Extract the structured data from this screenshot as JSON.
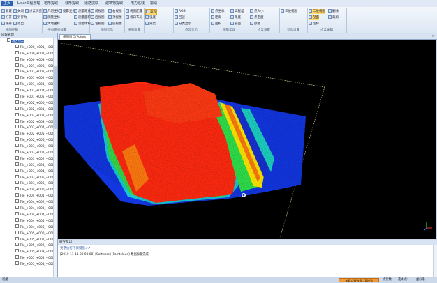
{
  "menu": {
    "tabs": [
      "主页",
      "Lidar工程管理",
      "地形提取",
      "线形提取",
      "道路提取",
      "建筑物提取",
      "电力巡线",
      "帮助"
    ],
    "active": 0
  },
  "ribbon": {
    "groups": [
      {
        "caption": "视图控制",
        "buttons": [
          "新建",
          "打开",
          "保存",
          "关闭",
          "另存为",
          "退出"
        ]
      },
      {
        "caption": "",
        "buttons": [
          "点云浏览"
        ]
      },
      {
        "caption": "坐标系统设置",
        "buttons": [
          "几何坐标",
          "测量坐标",
          "大地坐标",
          "投影变换"
        ]
      },
      {
        "caption": "",
        "buttons": [
          "测量距离",
          "测量面积",
          "测量体积"
        ]
      },
      {
        "caption": "视图显示",
        "buttons": [
          "前视图",
          "后视图",
          "左视图",
          "右视图",
          "顶视图",
          "底视图"
        ]
      },
      {
        "caption": "视图设置",
        "buttons": [
          "视图配置",
          "视口布局"
        ]
      },
      {
        "caption": "",
        "buttons": [
          "高程",
          "强度",
          "分类"
        ]
      },
      {
        "caption": "点云显示",
        "buttons": [
          "RGB",
          "回波",
          "分类显示"
        ]
      },
      {
        "caption": "测量工具",
        "buttons": [
          "点坐标",
          "距离",
          "面积",
          "高程差",
          "角度",
          "剖面"
        ]
      },
      {
        "caption": "点云设置",
        "buttons": [
          "点大小",
          "点密度",
          "颜色"
        ]
      },
      {
        "caption": "显示设置",
        "buttons": [
          "三维视图"
        ]
      },
      {
        "caption": "点云编辑",
        "buttons": [
          "二维视图",
          "剖面",
          "选择",
          "删除",
          "裁剪"
        ]
      }
    ]
  },
  "left_panel": {
    "title": "内容管理",
    "root": "测区点云",
    "nodes": [
      "Tile_+000_+001_+000",
      "Tile_+000_+002_+000",
      "Tile_+000_+003_+000",
      "Tile_+001_+000_+000",
      "Tile_+001_+001_+000",
      "Tile_+001_+002_+000",
      "Tile_+001_+003_+000",
      "Tile_+001_+004_+000",
      "Tile_+001_+005_+000",
      "Tile_+002_+000_+000",
      "Tile_+002_+001_+000",
      "Tile_+002_+002_+000",
      "Tile_+002_+003_+000",
      "Tile_+002_+004_+000",
      "Tile_+002_+005_+000",
      "Tile_+002_+006_+000",
      "Tile_+003_+000_+000",
      "Tile_+003_+001_+000",
      "Tile_+003_+002_+000",
      "Tile_+003_+003_+000",
      "Tile_+003_+004_+000",
      "Tile_+003_+005_+000",
      "Tile_+003_+006_+000",
      "Tile_+004_+000_+000",
      "Tile_+004_+001_+000",
      "Tile_+004_+002_+000",
      "Tile_+004_+003_+000",
      "Tile_+004_+004_+000",
      "Tile_+004_+005_+000",
      "Tile_+004_+006_+000",
      "Tile_+005_+000_+000",
      "Tile_+005_+001_+000",
      "Tile_+005_+002_+000",
      "Tile_+005_+003_+000",
      "Tile_+005_+004_+000",
      "Tile_+005_+005_+000"
    ]
  },
  "document": {
    "tab_label": "视图窗口(Points)",
    "close": "×"
  },
  "console": {
    "title": "命令窗口",
    "hint": "要求执行下去键盘>>",
    "log": "[2019-11-11 00:00:00] [Software] [Pointcloud] 数据加载完成!"
  },
  "statusbar": {
    "left": "就绪",
    "progress": "加载点云数据...100%",
    "items": [
      "点云数:",
      "选中点:",
      "坐标系"
    ]
  },
  "colors": {
    "ribbon_active_tab": "#2c62b0",
    "selected_button": "#ffd86b",
    "viewport_bg": "#000000",
    "cloud_high": "#ff2a10",
    "cloud_mid": "#ffe600",
    "cloud_low": "#1030e0",
    "status_orange": "#f29b34"
  }
}
